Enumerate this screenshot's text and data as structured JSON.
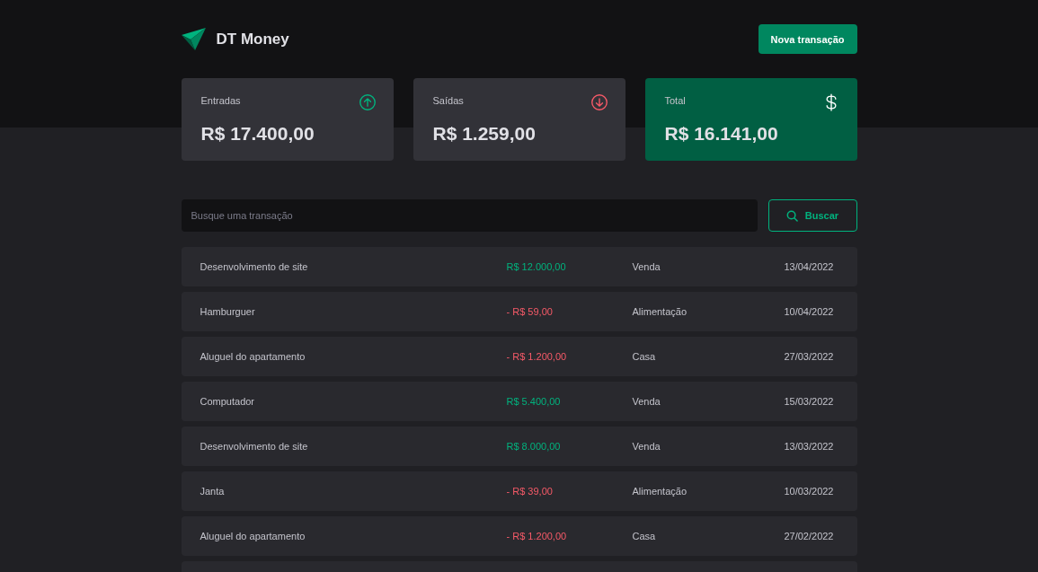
{
  "header": {
    "logo_text": "DT Money",
    "new_button": "Nova transação"
  },
  "summary": [
    {
      "kind": "income",
      "label": "Entradas",
      "value": "R$ 17.400,00"
    },
    {
      "kind": "outcome",
      "label": "Saídas",
      "value": "R$ 1.259,00"
    },
    {
      "kind": "total",
      "label": "Total",
      "value": "R$ 16.141,00"
    }
  ],
  "search": {
    "placeholder": "Busque uma transação",
    "button": "Buscar"
  },
  "transactions": [
    {
      "description": "Desenvolvimento de site",
      "amount": "R$ 12.000,00",
      "kind": "income",
      "category": "Venda",
      "date": "13/04/2022"
    },
    {
      "description": "Hamburguer",
      "amount": "- R$ 59,00",
      "kind": "outcome",
      "category": "Alimentação",
      "date": "10/04/2022"
    },
    {
      "description": "Aluguel do apartamento",
      "amount": "- R$ 1.200,00",
      "kind": "outcome",
      "category": "Casa",
      "date": "27/03/2022"
    },
    {
      "description": "Computador",
      "amount": "R$ 5.400,00",
      "kind": "income",
      "category": "Venda",
      "date": "15/03/2022"
    },
    {
      "description": "Desenvolvimento de site",
      "amount": "R$ 8.000,00",
      "kind": "income",
      "category": "Venda",
      "date": "13/03/2022"
    },
    {
      "description": "Janta",
      "amount": "- R$ 39,00",
      "kind": "outcome",
      "category": "Alimentação",
      "date": "10/03/2022"
    },
    {
      "description": "Aluguel do apartamento",
      "amount": "- R$ 1.200,00",
      "kind": "outcome",
      "category": "Casa",
      "date": "27/02/2022"
    }
  ]
}
